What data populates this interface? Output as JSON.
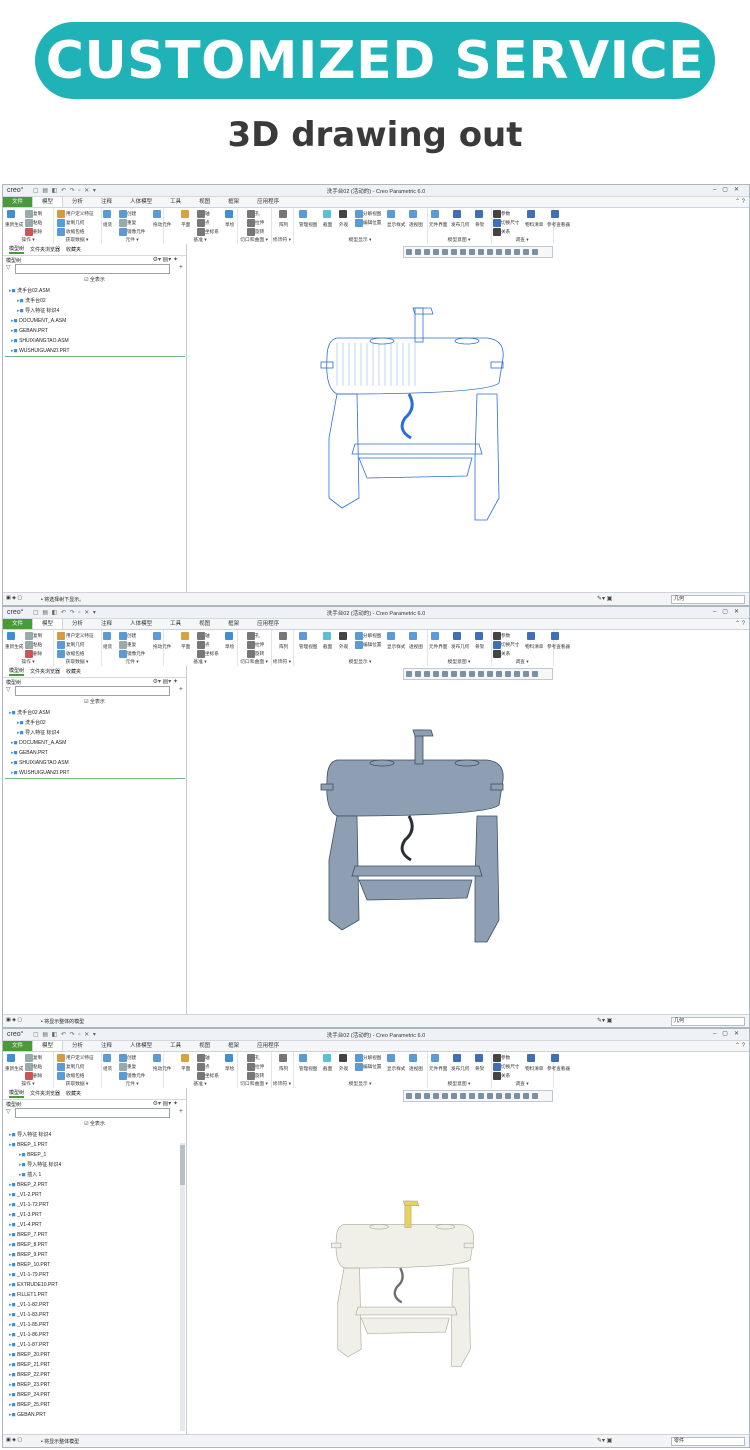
{
  "banner": {
    "title": "CUSTOMIZED SERVICE",
    "subtitle": "3D drawing out"
  },
  "app": {
    "logo": "creo°",
    "title": "洗手台02 (活动的) - Creo Parametric 6.0",
    "menus": [
      "文件",
      "模型",
      "分析",
      "注释",
      "人体模型",
      "工具",
      "视图",
      "框架",
      "应用程序"
    ],
    "ribbon": {
      "groups": [
        "操作 ▾",
        "获取数据 ▾",
        "元件 ▾",
        "基准 ▾",
        "切口和曲面 ▾",
        "修饰符 ▾",
        "模型显示 ▾",
        "模型意图 ▾",
        "调查 ▾"
      ],
      "items": {
        "regen": "重新生成",
        "copy": "复制",
        "paste": "粘贴",
        "delete": "删除",
        "udf": "用户定义特征",
        "copy_geom": "复制几何",
        "shrinkwrap": "收缩包络",
        "assemble": "组装",
        "create": "创建",
        "repeat": "重复",
        "mirror_comp": "镜像元件",
        "drag": "拖动元件",
        "plane": "平面",
        "axis": "轴",
        "point": "点",
        "csys": "坐标系",
        "sketch": "草绘",
        "hole": "孔",
        "extrude": "拉伸",
        "revolve": "旋转",
        "pattern": "阵列",
        "manage_views": "管理视图",
        "section": "截面",
        "appearance": "外观",
        "exploded": "分解视图",
        "edit_position": "编辑位置",
        "display_style": "显示样式",
        "perspective": "透视图",
        "comp_interface": "元件界面",
        "pub_geom": "发布几何",
        "skeleton": "骨架",
        "params": "参数",
        "switch_dims": "切换尺寸",
        "relations": "关系",
        "bom": "物料清单",
        "ref_viewer": "参考查看器"
      }
    },
    "left_panel": {
      "tabs": [
        "模型树",
        "文件夹浏览器",
        "收藏夹"
      ],
      "header": "模型树",
      "show_button": "☑ 全表示"
    }
  },
  "windows": [
    {
      "name": "wireframe",
      "tree": [
        "洗手台02.ASM",
        "洗手台02",
        "导入特征 标识4",
        "DOCUMENT_A.ASM",
        "GEBAN.PRT",
        "SHUIXIANGTAO.ASM",
        "WUSHUIGUANZI.PRT"
      ],
      "status": "• 将选择树下显示。",
      "filter": "几何"
    },
    {
      "name": "shaded",
      "tree": [
        "洗手台02.ASM",
        "洗手台02",
        "导入特征 标识4",
        "DOCUMENT_A.ASM",
        "GEBAN.PRT",
        "SHUIXIANGTAO.ASM",
        "WUSHUIGUANZI.PRT"
      ],
      "status": "• 将显示整体的模型",
      "filter": "几何"
    },
    {
      "name": "rendered",
      "tree": [
        "导入特征 标识4",
        "BREP_1.PRT",
        "BREP_1",
        "导入特征 标识4",
        "插入 1",
        "BREP_2.PRT",
        "_V1-2.PRT",
        "_V1-1-72.PRT",
        "_V1-3.PRT",
        "_V1-4.PRT",
        "BREP_7.PRT",
        "BREP_8.PRT",
        "BREP_9.PRT",
        "BREP_10.PRT",
        "_V1-1-79.PRT",
        "EXTRUDE10.PRT",
        "FILLET1.PRT",
        "_V1-1-82.PRT",
        "_V1-1-83.PRT",
        "_V1-1-85.PRT",
        "_V1-1-86.PRT",
        "_V1-1-87.PRT",
        "BREP_20.PRT",
        "BREP_21.PRT",
        "BREP_22.PRT",
        "BREP_23.PRT",
        "BREP_24.PRT",
        "BREP_25.PRT",
        "GEBAN.PRT"
      ],
      "status": "• 将显示整体模型",
      "filter": "零件"
    }
  ],
  "colors": {
    "teal": "#1fb3b8",
    "file_tab": "#4a9a3c",
    "wire": "#2a6fd6",
    "shade": "#8e9fb3",
    "render": "#f1f0e8",
    "faucet_yellow": "#e7d35a"
  }
}
